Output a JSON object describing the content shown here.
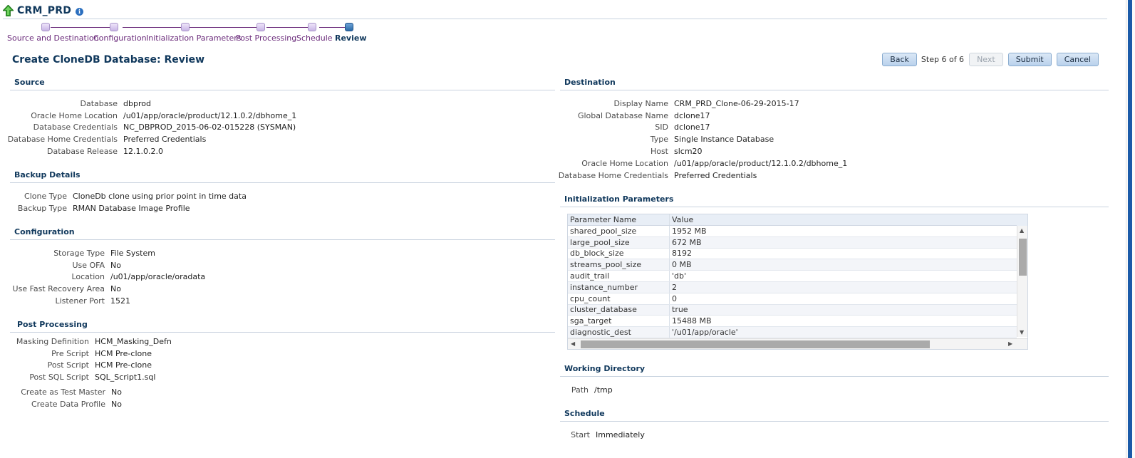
{
  "header": {
    "title": "CRM_PRD",
    "target_icon": "up-arrow-icon",
    "info_icon": "info-icon"
  },
  "train": {
    "steps": [
      {
        "label": "Source and Destination",
        "current": false
      },
      {
        "label": "Configuration",
        "current": false
      },
      {
        "label": "Initialization Parameters",
        "current": false
      },
      {
        "label": "Post Processing",
        "current": false
      },
      {
        "label": "Schedule",
        "current": false
      },
      {
        "label": "Review",
        "current": true
      }
    ]
  },
  "page_title": "Create CloneDB Database: Review",
  "nav": {
    "back": "Back",
    "step_text": "Step 6 of 6",
    "next": "Next",
    "submit": "Submit",
    "cancel": "Cancel"
  },
  "source": {
    "heading": "Source",
    "rows": [
      {
        "label": "Database",
        "value": "dbprod"
      },
      {
        "label": "Oracle Home Location",
        "value": "/u01/app/oracle/product/12.1.0.2/dbhome_1"
      },
      {
        "label": "Database Credentials",
        "value": "NC_DBPROD_2015-06-02-015228 (SYSMAN)"
      },
      {
        "label": "Database Home Credentials",
        "value": "Preferred Credentials"
      },
      {
        "label": "Database Release",
        "value": "12.1.0.2.0"
      }
    ]
  },
  "backup": {
    "heading": "Backup Details",
    "rows": [
      {
        "label": "Clone Type",
        "value": "CloneDb clone using prior point in time data"
      },
      {
        "label": "Backup Type",
        "value": "RMAN Database Image Profile"
      }
    ]
  },
  "configuration": {
    "heading": "Configuration",
    "rows": [
      {
        "label": "Storage Type",
        "value": "File System"
      },
      {
        "label": "Use OFA",
        "value": "No"
      },
      {
        "label": "Location",
        "value": "/u01/app/oracle/oradata"
      },
      {
        "label": "Use Fast Recovery Area",
        "value": "No"
      },
      {
        "label": "Listener Port",
        "value": "1521"
      }
    ]
  },
  "post_processing": {
    "heading": "Post Processing",
    "rows": [
      {
        "label": "Masking Definition",
        "value": "HCM_Masking_Defn"
      },
      {
        "label": "Pre Script",
        "value": "HCM Pre-clone"
      },
      {
        "label": "Post Script",
        "value": "HCM Pre-clone"
      },
      {
        "label": "Post SQL Script",
        "value": "SQL_Script1.sql"
      }
    ],
    "rows2": [
      {
        "label": "Create as Test Master",
        "value": "No"
      },
      {
        "label": "Create Data Profile",
        "value": "No"
      }
    ]
  },
  "destination": {
    "heading": "Destination",
    "rows": [
      {
        "label": "Display Name",
        "value": "CRM_PRD_Clone-06-29-2015-17"
      },
      {
        "label": "Global Database Name",
        "value": "dclone17"
      },
      {
        "label": "SID",
        "value": "dclone17"
      },
      {
        "label": "Type",
        "value": "Single Instance Database"
      },
      {
        "label": "Host",
        "value": "slcm20"
      },
      {
        "label": "Oracle Home Location",
        "value": "/u01/app/oracle/product/12.1.0.2/dbhome_1"
      },
      {
        "label": "Database Home Credentials",
        "value": "Preferred Credentials"
      }
    ]
  },
  "init_params": {
    "heading": "Initialization Parameters",
    "columns": [
      "Parameter Name",
      "Value"
    ],
    "rows": [
      [
        "shared_pool_size",
        "1952 MB"
      ],
      [
        "large_pool_size",
        "672 MB"
      ],
      [
        "db_block_size",
        "8192"
      ],
      [
        "streams_pool_size",
        "0 MB"
      ],
      [
        "audit_trail",
        "'db'"
      ],
      [
        "instance_number",
        "2"
      ],
      [
        "cpu_count",
        "0"
      ],
      [
        "cluster_database",
        "true"
      ],
      [
        "sga_target",
        "15488 MB"
      ],
      [
        "diagnostic_dest",
        "'/u01/app/oracle'"
      ]
    ]
  },
  "working_directory": {
    "heading": "Working Directory",
    "rows": [
      {
        "label": "Path",
        "value": "/tmp"
      }
    ]
  },
  "schedule": {
    "heading": "Schedule",
    "rows": [
      {
        "label": "Start",
        "value": "Immediately"
      }
    ]
  }
}
